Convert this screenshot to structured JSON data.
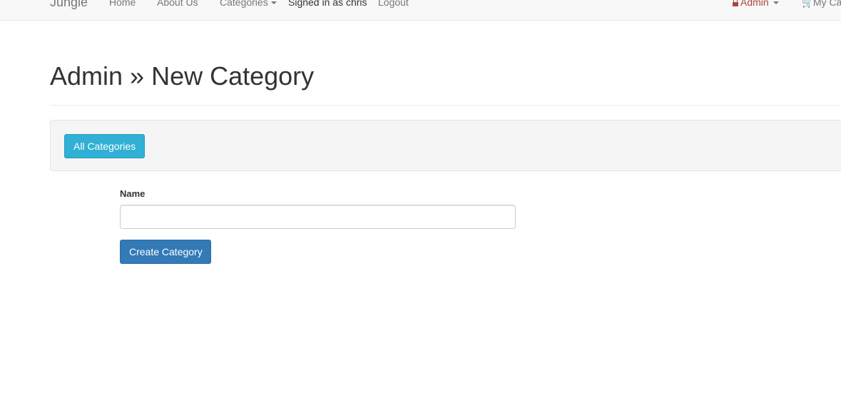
{
  "navbar": {
    "brand": "Jungle",
    "links": {
      "home": "Home",
      "about": "About Us",
      "categories": "Categories"
    },
    "signed_in_text": "Signed in as chris",
    "logout": "Logout",
    "admin": "Admin",
    "cart": "My Cart"
  },
  "page": {
    "title": "Admin » New Category"
  },
  "toolbar": {
    "all_categories_label": "All Categories"
  },
  "form": {
    "name_label": "Name",
    "name_value": "",
    "submit_label": "Create Category"
  },
  "colors": {
    "navbar_bg": "#f8f8f8",
    "admin_text": "#a94442",
    "info_button": "#31b0d5",
    "primary_button": "#337ab7",
    "well_bg": "#f5f5f5"
  },
  "icons": {
    "admin": "lock-icon",
    "cart": "shopping-cart-icon",
    "dropdown": "caret-down-icon"
  }
}
